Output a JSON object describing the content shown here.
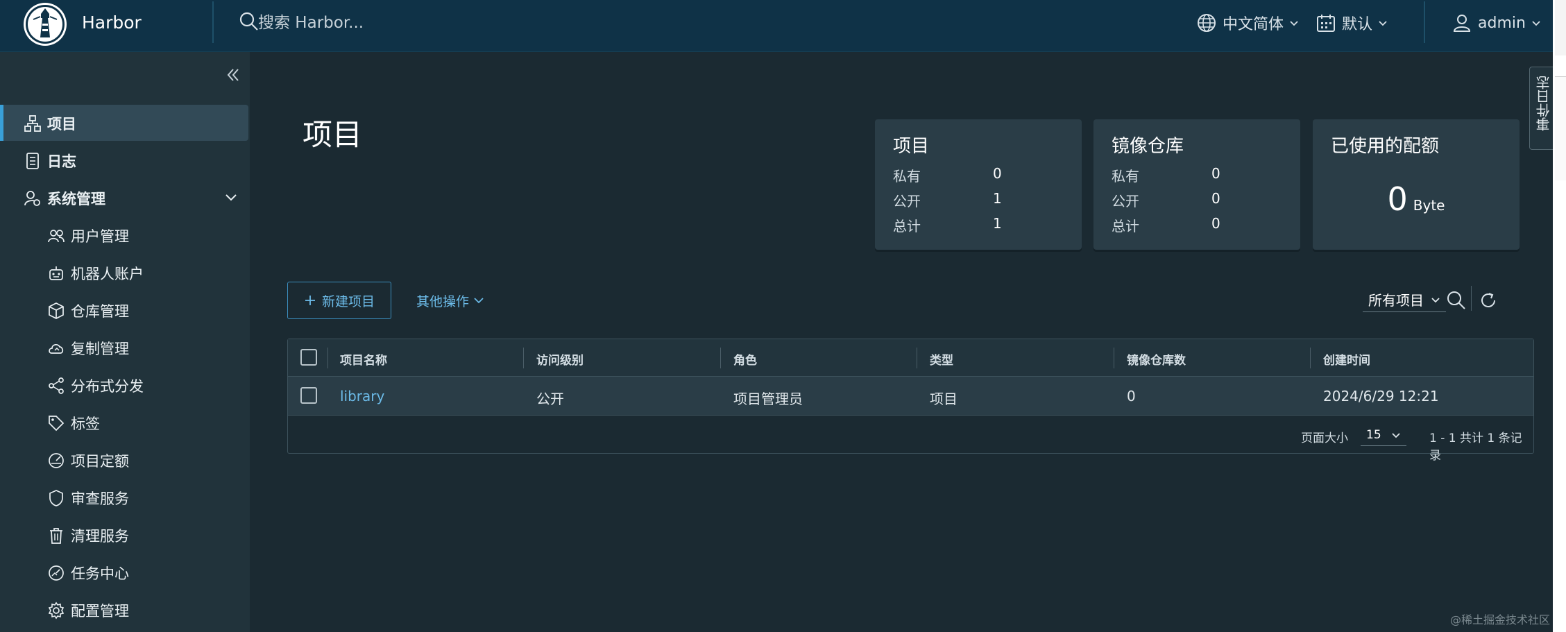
{
  "header": {
    "brand": "Harbor",
    "search_placeholder": "搜索 Harbor...",
    "language": "中文简体",
    "theme": "默认",
    "user": "admin"
  },
  "sidebar": {
    "items": [
      {
        "label": "项目",
        "icon": "projects-icon"
      },
      {
        "label": "日志",
        "icon": "logs-icon"
      },
      {
        "label": "系统管理",
        "icon": "admin-icon"
      }
    ],
    "sub_items": [
      {
        "label": "用户管理",
        "icon": "users-icon"
      },
      {
        "label": "机器人账户",
        "icon": "robot-icon"
      },
      {
        "label": "仓库管理",
        "icon": "registry-icon"
      },
      {
        "label": "复制管理",
        "icon": "replication-icon"
      },
      {
        "label": "分布式分发",
        "icon": "share-icon"
      },
      {
        "label": "标签",
        "icon": "tag-icon"
      },
      {
        "label": "项目定额",
        "icon": "quota-icon"
      },
      {
        "label": "审查服务",
        "icon": "shield-icon"
      },
      {
        "label": "清理服务",
        "icon": "trash-icon"
      },
      {
        "label": "任务中心",
        "icon": "dashboard-icon"
      },
      {
        "label": "配置管理",
        "icon": "gear-icon"
      }
    ]
  },
  "page": {
    "title": "项目"
  },
  "cards": {
    "projects": {
      "title": "项目",
      "private_label": "私有",
      "private": "0",
      "public_label": "公开",
      "public": "1",
      "total_label": "总计",
      "total": "1"
    },
    "repos": {
      "title": "镜像仓库",
      "private_label": "私有",
      "private": "0",
      "public_label": "公开",
      "public": "0",
      "total_label": "总计",
      "total": "0"
    },
    "quota": {
      "title": "已使用的配额",
      "value": "0",
      "unit": "Byte"
    }
  },
  "toolbar": {
    "new_project": "新建项目",
    "other_ops": "其他操作",
    "filter": "所有项目"
  },
  "table": {
    "columns": [
      "项目名称",
      "访问级别",
      "角色",
      "类型",
      "镜像仓库数",
      "创建时间"
    ],
    "rows": [
      {
        "name": "library",
        "access": "公开",
        "role": "项目管理员",
        "type": "项目",
        "repo_count": "0",
        "created": "2024/6/29 12:21"
      }
    ],
    "page_size_label": "页面大小",
    "page_size": "15",
    "page_info": "1 - 1 共计 1 条记录"
  },
  "side_tab": "事件日志",
  "watermark": "@稀土掘金技术社区",
  "colors": {
    "header_bg": "#0f3247",
    "sidebar_bg": "#21333b",
    "main_bg": "#1b2a32",
    "accent": "#39a0d8",
    "link": "#6cbbe8"
  }
}
